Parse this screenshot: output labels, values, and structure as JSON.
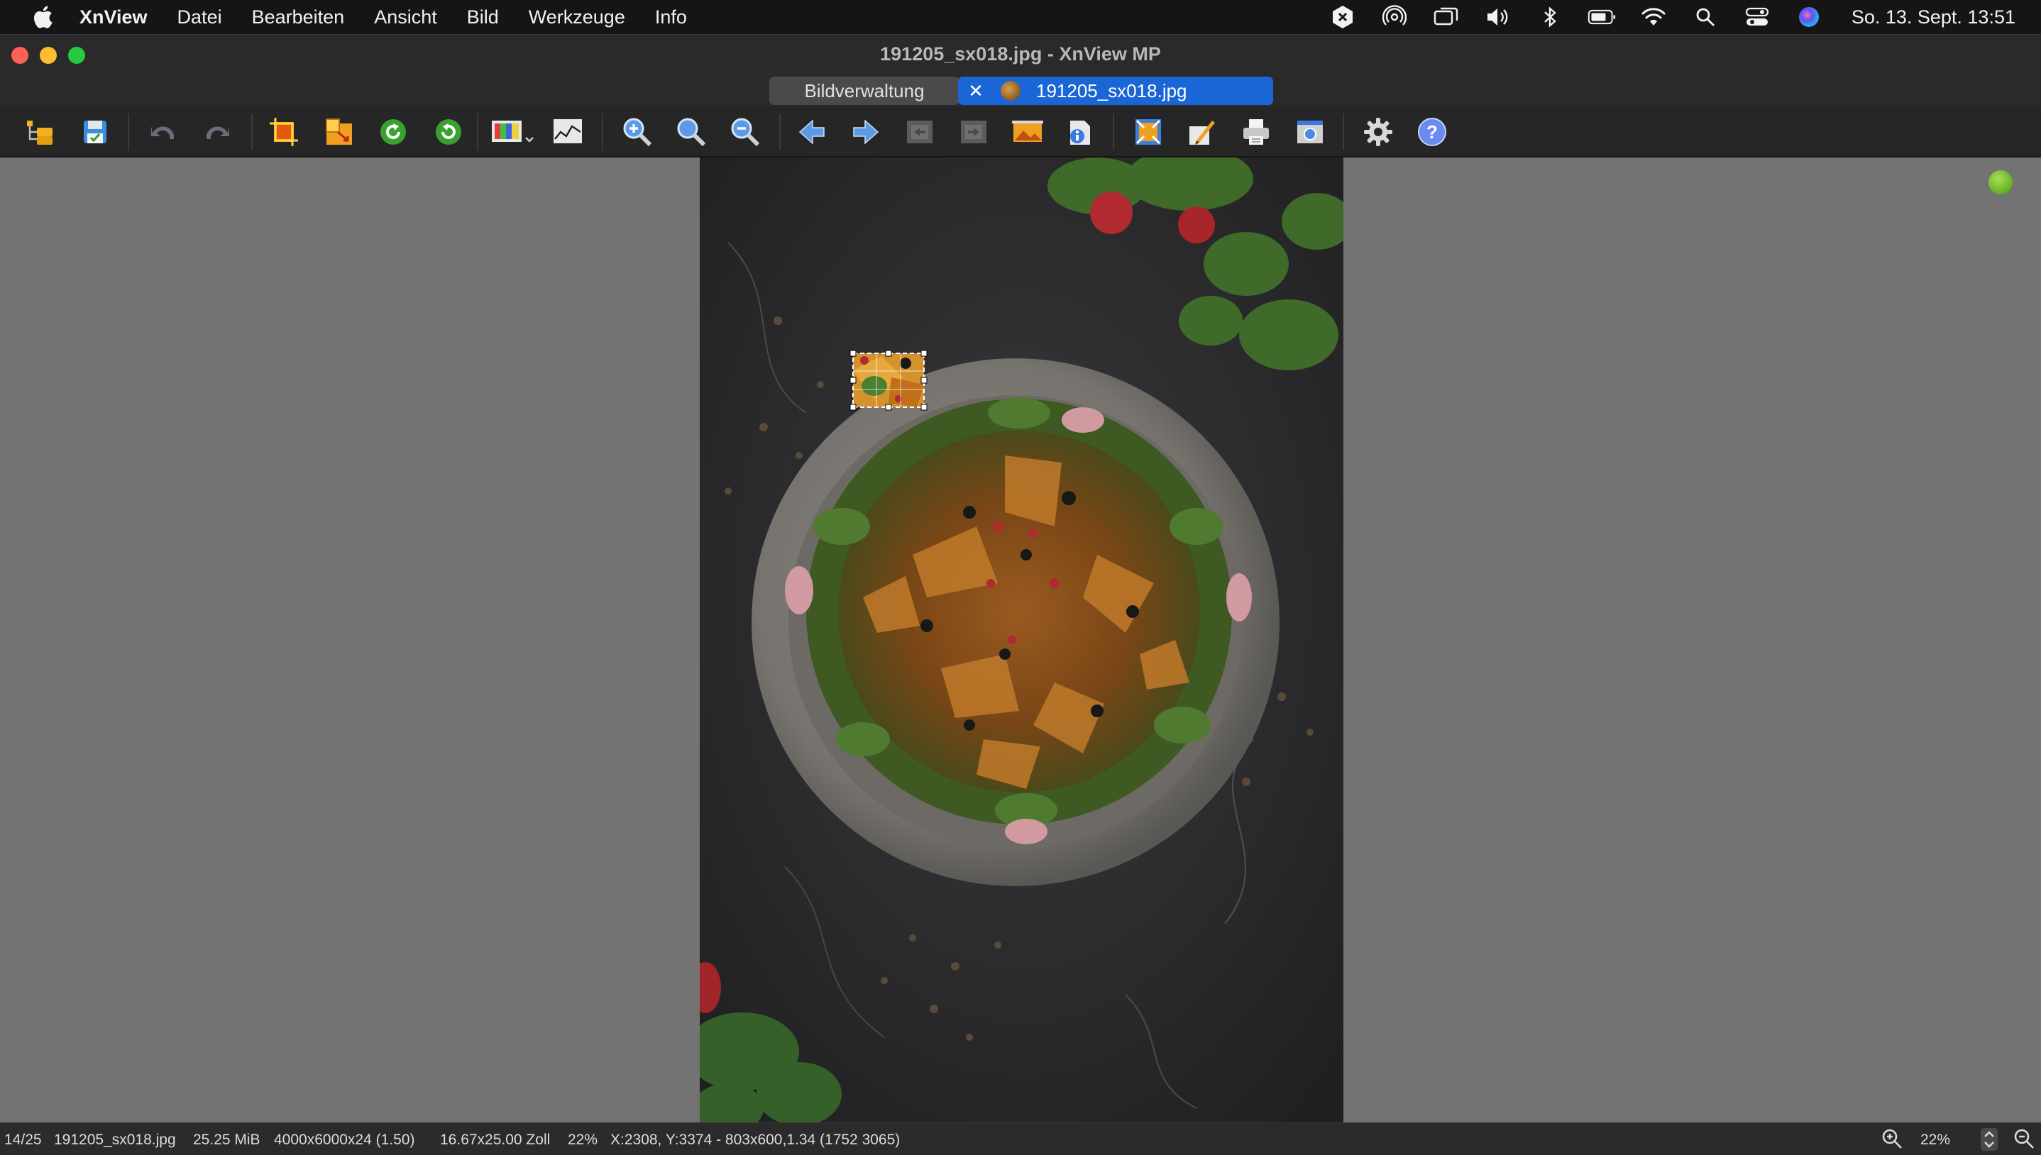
{
  "menubar": {
    "apple_icon": "apple-logo",
    "app_name": "XnView",
    "items": [
      "Datei",
      "Bearbeiten",
      "Ansicht",
      "Bild",
      "Werkzeuge",
      "Info"
    ],
    "status_icons": [
      "snip-icon",
      "airdrop-icon",
      "screen-mirror-icon",
      "volume-icon",
      "bluetooth-icon",
      "battery-icon",
      "wifi-icon",
      "search-icon",
      "control-center-icon",
      "siri-icon"
    ],
    "clock": "So. 13. Sept.  13:51"
  },
  "window": {
    "title": "191205_sx018.jpg - XnView MP"
  },
  "tabs": [
    {
      "label": "Bildverwaltung",
      "active": false
    },
    {
      "label": "191205_sx018.jpg",
      "active": true
    }
  ],
  "toolbar": {
    "buttons": [
      "browser-icon",
      "save-icon",
      "undo-icon",
      "redo-icon",
      "crop-icon",
      "resize-icon",
      "rotate-left-icon",
      "rotate-right-icon",
      "adjust-colors-icon",
      "levels-icon",
      "zoom-in-icon",
      "zoom-fit-icon",
      "zoom-out-icon",
      "previous-icon",
      "next-icon",
      "first-icon",
      "last-icon",
      "slideshow-icon",
      "properties-icon",
      "fullscreen-icon",
      "edit-icon",
      "print-icon",
      "capture-icon",
      "settings-icon",
      "help-icon"
    ]
  },
  "statusbar": {
    "index": "14/25",
    "filename": "191205_sx018.jpg",
    "filesize": "25.25 MiB",
    "dimensions": "4000x6000x24 (1.50)",
    "print_size": "16.67x25.00 Zoll",
    "zoom_percent": "22%",
    "selection": "X:2308, Y:3374 - 803x600,1.34 (1752 3065)",
    "zoom_value": "22%"
  },
  "colors": {
    "accent": "#1b66d6",
    "canvas_bg": "#737373"
  }
}
